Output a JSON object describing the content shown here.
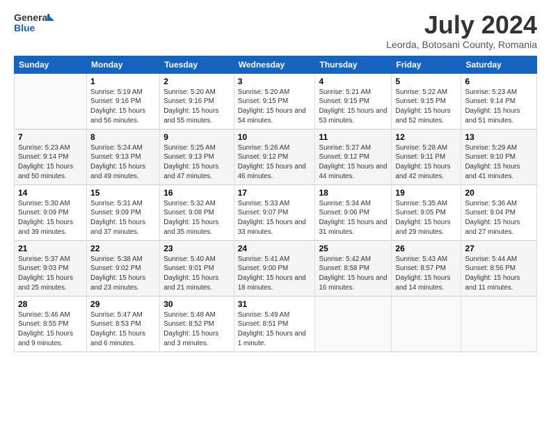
{
  "logo": {
    "general": "General",
    "blue": "Blue"
  },
  "title": {
    "month_year": "July 2024",
    "location": "Leorda, Botosani County, Romania"
  },
  "weekdays": [
    "Sunday",
    "Monday",
    "Tuesday",
    "Wednesday",
    "Thursday",
    "Friday",
    "Saturday"
  ],
  "weeks": [
    [
      {
        "day": "",
        "sunrise": "",
        "sunset": "",
        "daylight": ""
      },
      {
        "day": "1",
        "sunrise": "Sunrise: 5:19 AM",
        "sunset": "Sunset: 9:16 PM",
        "daylight": "Daylight: 15 hours and 56 minutes."
      },
      {
        "day": "2",
        "sunrise": "Sunrise: 5:20 AM",
        "sunset": "Sunset: 9:16 PM",
        "daylight": "Daylight: 15 hours and 55 minutes."
      },
      {
        "day": "3",
        "sunrise": "Sunrise: 5:20 AM",
        "sunset": "Sunset: 9:15 PM",
        "daylight": "Daylight: 15 hours and 54 minutes."
      },
      {
        "day": "4",
        "sunrise": "Sunrise: 5:21 AM",
        "sunset": "Sunset: 9:15 PM",
        "daylight": "Daylight: 15 hours and 53 minutes."
      },
      {
        "day": "5",
        "sunrise": "Sunrise: 5:22 AM",
        "sunset": "Sunset: 9:15 PM",
        "daylight": "Daylight: 15 hours and 52 minutes."
      },
      {
        "day": "6",
        "sunrise": "Sunrise: 5:23 AM",
        "sunset": "Sunset: 9:14 PM",
        "daylight": "Daylight: 15 hours and 51 minutes."
      }
    ],
    [
      {
        "day": "7",
        "sunrise": "Sunrise: 5:23 AM",
        "sunset": "Sunset: 9:14 PM",
        "daylight": "Daylight: 15 hours and 50 minutes."
      },
      {
        "day": "8",
        "sunrise": "Sunrise: 5:24 AM",
        "sunset": "Sunset: 9:13 PM",
        "daylight": "Daylight: 15 hours and 49 minutes."
      },
      {
        "day": "9",
        "sunrise": "Sunrise: 5:25 AM",
        "sunset": "Sunset: 9:13 PM",
        "daylight": "Daylight: 15 hours and 47 minutes."
      },
      {
        "day": "10",
        "sunrise": "Sunrise: 5:26 AM",
        "sunset": "Sunset: 9:12 PM",
        "daylight": "Daylight: 15 hours and 46 minutes."
      },
      {
        "day": "11",
        "sunrise": "Sunrise: 5:27 AM",
        "sunset": "Sunset: 9:12 PM",
        "daylight": "Daylight: 15 hours and 44 minutes."
      },
      {
        "day": "12",
        "sunrise": "Sunrise: 5:28 AM",
        "sunset": "Sunset: 9:11 PM",
        "daylight": "Daylight: 15 hours and 42 minutes."
      },
      {
        "day": "13",
        "sunrise": "Sunrise: 5:29 AM",
        "sunset": "Sunset: 9:10 PM",
        "daylight": "Daylight: 15 hours and 41 minutes."
      }
    ],
    [
      {
        "day": "14",
        "sunrise": "Sunrise: 5:30 AM",
        "sunset": "Sunset: 9:09 PM",
        "daylight": "Daylight: 15 hours and 39 minutes."
      },
      {
        "day": "15",
        "sunrise": "Sunrise: 5:31 AM",
        "sunset": "Sunset: 9:09 PM",
        "daylight": "Daylight: 15 hours and 37 minutes."
      },
      {
        "day": "16",
        "sunrise": "Sunrise: 5:32 AM",
        "sunset": "Sunset: 9:08 PM",
        "daylight": "Daylight: 15 hours and 35 minutes."
      },
      {
        "day": "17",
        "sunrise": "Sunrise: 5:33 AM",
        "sunset": "Sunset: 9:07 PM",
        "daylight": "Daylight: 15 hours and 33 minutes."
      },
      {
        "day": "18",
        "sunrise": "Sunrise: 5:34 AM",
        "sunset": "Sunset: 9:06 PM",
        "daylight": "Daylight: 15 hours and 31 minutes."
      },
      {
        "day": "19",
        "sunrise": "Sunrise: 5:35 AM",
        "sunset": "Sunset: 9:05 PM",
        "daylight": "Daylight: 15 hours and 29 minutes."
      },
      {
        "day": "20",
        "sunrise": "Sunrise: 5:36 AM",
        "sunset": "Sunset: 9:04 PM",
        "daylight": "Daylight: 15 hours and 27 minutes."
      }
    ],
    [
      {
        "day": "21",
        "sunrise": "Sunrise: 5:37 AM",
        "sunset": "Sunset: 9:03 PM",
        "daylight": "Daylight: 15 hours and 25 minutes."
      },
      {
        "day": "22",
        "sunrise": "Sunrise: 5:38 AM",
        "sunset": "Sunset: 9:02 PM",
        "daylight": "Daylight: 15 hours and 23 minutes."
      },
      {
        "day": "23",
        "sunrise": "Sunrise: 5:40 AM",
        "sunset": "Sunset: 9:01 PM",
        "daylight": "Daylight: 15 hours and 21 minutes."
      },
      {
        "day": "24",
        "sunrise": "Sunrise: 5:41 AM",
        "sunset": "Sunset: 9:00 PM",
        "daylight": "Daylight: 15 hours and 18 minutes."
      },
      {
        "day": "25",
        "sunrise": "Sunrise: 5:42 AM",
        "sunset": "Sunset: 8:58 PM",
        "daylight": "Daylight: 15 hours and 16 minutes."
      },
      {
        "day": "26",
        "sunrise": "Sunrise: 5:43 AM",
        "sunset": "Sunset: 8:57 PM",
        "daylight": "Daylight: 15 hours and 14 minutes."
      },
      {
        "day": "27",
        "sunrise": "Sunrise: 5:44 AM",
        "sunset": "Sunset: 8:56 PM",
        "daylight": "Daylight: 15 hours and 11 minutes."
      }
    ],
    [
      {
        "day": "28",
        "sunrise": "Sunrise: 5:46 AM",
        "sunset": "Sunset: 8:55 PM",
        "daylight": "Daylight: 15 hours and 9 minutes."
      },
      {
        "day": "29",
        "sunrise": "Sunrise: 5:47 AM",
        "sunset": "Sunset: 8:53 PM",
        "daylight": "Daylight: 15 hours and 6 minutes."
      },
      {
        "day": "30",
        "sunrise": "Sunrise: 5:48 AM",
        "sunset": "Sunset: 8:52 PM",
        "daylight": "Daylight: 15 hours and 3 minutes."
      },
      {
        "day": "31",
        "sunrise": "Sunrise: 5:49 AM",
        "sunset": "Sunset: 8:51 PM",
        "daylight": "Daylight: 15 hours and 1 minute."
      },
      {
        "day": "",
        "sunrise": "",
        "sunset": "",
        "daylight": ""
      },
      {
        "day": "",
        "sunrise": "",
        "sunset": "",
        "daylight": ""
      },
      {
        "day": "",
        "sunrise": "",
        "sunset": "",
        "daylight": ""
      }
    ]
  ]
}
